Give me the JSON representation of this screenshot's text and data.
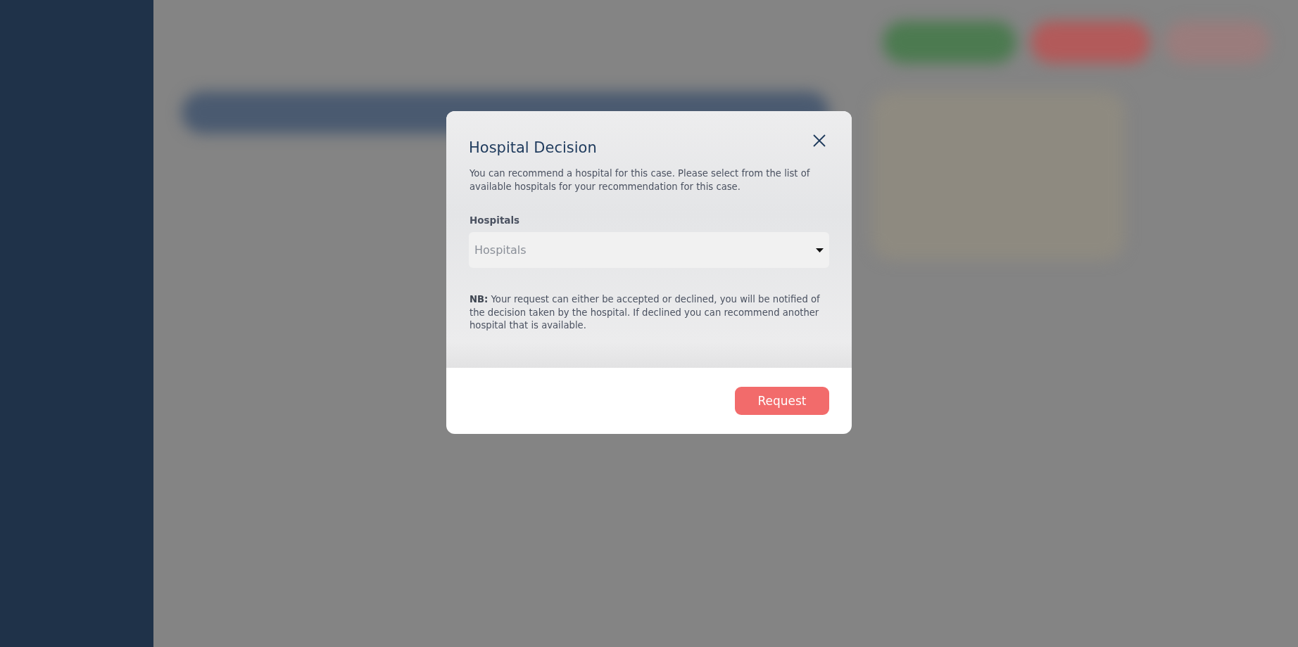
{
  "dialog": {
    "title": "Hospital Decision",
    "description": "You can recommend a hospital for this case. Please select from the list of available hospitals for your recommendation for this case.",
    "field": {
      "label": "Hospitals",
      "placeholder": "Hospitals"
    },
    "note": "**NB:** Your request can either be accepted or declined, you will be notified of the decision taken by the hospital. If declined you can recommend another hospital that is available.",
    "buttons": [
      "Request"
    ]
  }
}
